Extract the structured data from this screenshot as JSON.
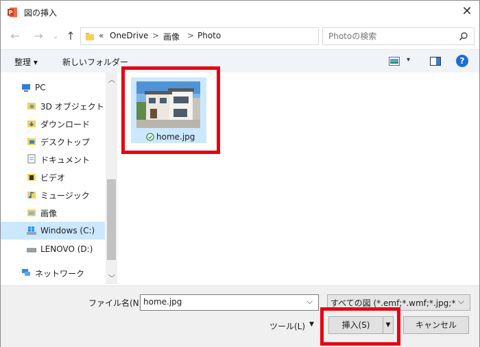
{
  "window": {
    "title": "図の挿入",
    "close": "✕"
  },
  "nav": {
    "back": "←",
    "forward": "→",
    "recent": "⌄",
    "up": "↑",
    "breadcrumb_prefix": "«",
    "breadcrumb": [
      "OneDrive",
      "画像",
      "Photo"
    ],
    "separator": ">",
    "dropdown": "⌵",
    "refresh": "↻"
  },
  "search": {
    "placeholder": "Photoの検索"
  },
  "toolbar": {
    "organize": "整理 ▾",
    "new_folder": "新しいフォルダー",
    "view_arrow": "▾",
    "help": "?"
  },
  "sidebar": {
    "items": [
      {
        "label": "PC",
        "icon": "pc-icon"
      },
      {
        "label": "3D オブジェクト",
        "icon": "3d-objects-folder-icon"
      },
      {
        "label": "ダウンロード",
        "icon": "downloads-folder-icon"
      },
      {
        "label": "デスクトップ",
        "icon": "desktop-folder-icon"
      },
      {
        "label": "ドキュメント",
        "icon": "documents-folder-icon"
      },
      {
        "label": "ビデオ",
        "icon": "videos-folder-icon"
      },
      {
        "label": "ミュージック",
        "icon": "music-folder-icon"
      },
      {
        "label": "画像",
        "icon": "pictures-folder-icon"
      },
      {
        "label": "Windows (C:)",
        "icon": "drive-c-icon",
        "selected": true
      },
      {
        "label": "LENOVO (D:)",
        "icon": "drive-d-icon"
      },
      {
        "label": "ネットワーク",
        "icon": "network-icon"
      }
    ]
  },
  "files": [
    {
      "name": "home.jpg",
      "status_icon": "sync-check-icon",
      "selected": true
    }
  ],
  "bottom": {
    "filename_label": "ファイル名(N):",
    "filename_value": "home.jpg",
    "filetype": "すべての図 (*.emf;*.wmf;*.jpg;*.jp",
    "tools": "ツール(L)",
    "tools_arrow": "▼",
    "insert": "挿入(S)",
    "insert_arrow": "▼",
    "cancel": "キャンセル"
  },
  "colors": {
    "highlight_red": "#e60012",
    "selection": "#cce8ff",
    "help_blue": "#1a6fd6"
  }
}
